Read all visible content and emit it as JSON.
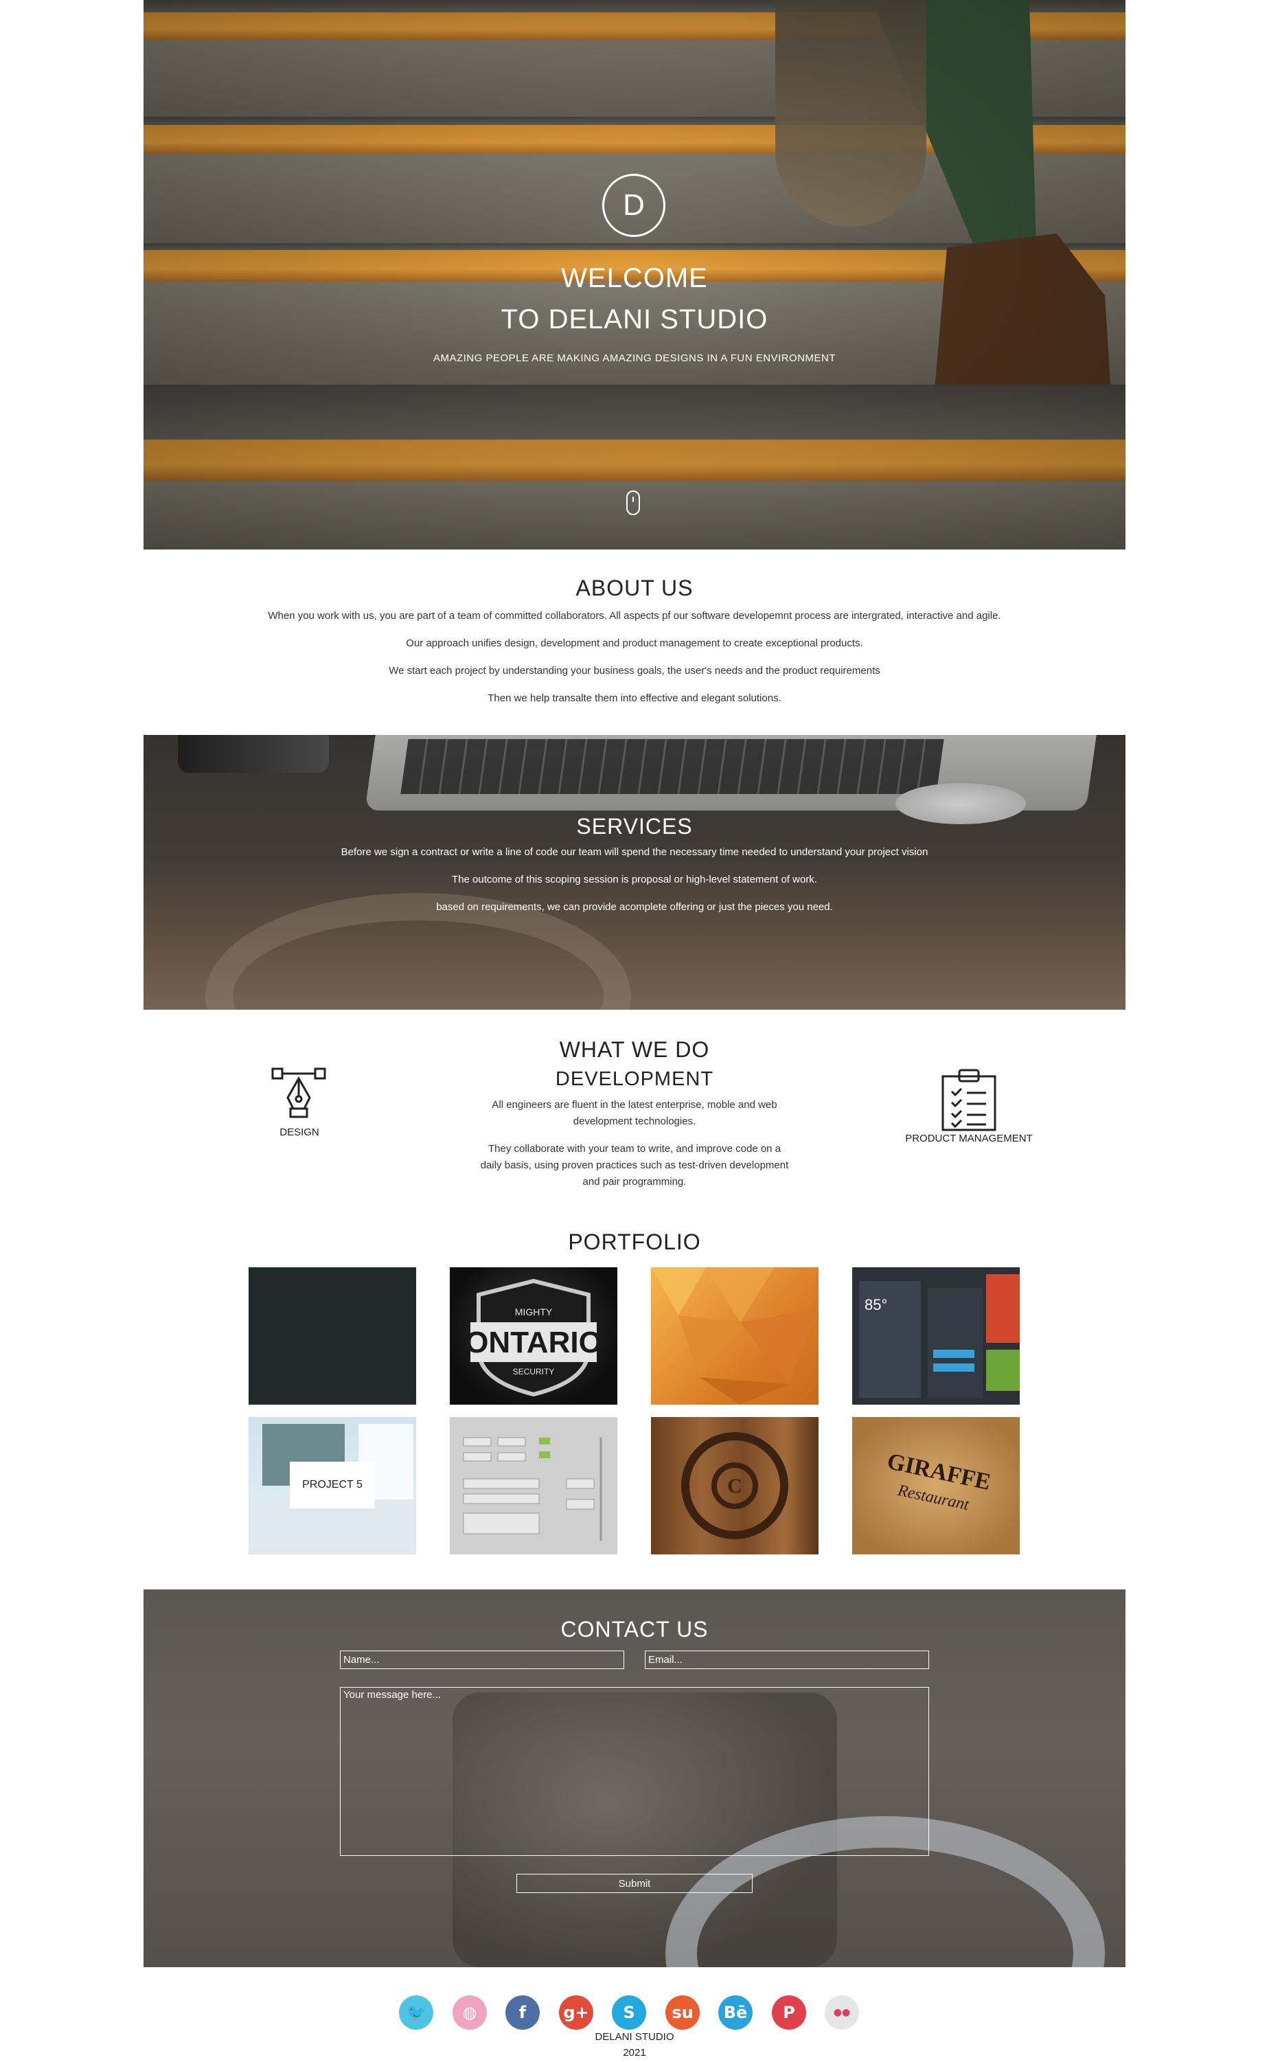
{
  "hero": {
    "logo_letter": "D",
    "title_line1": "WELCOME",
    "title_line2": "TO DELANI STUDIO",
    "tagline": "AMAZING PEOPLE ARE MAKING AMAZING DESIGNS IN A FUN ENVIRONMENT",
    "scroll_icon": "mouse-scroll-icon"
  },
  "about": {
    "title": "ABOUT US",
    "paragraphs": [
      "When you work with us, you are part of a team of committed collaborators. All aspects pf our software developemnt process are intergrated, interactive and agile.",
      "Our approach unifies design, development and product management to create exceptional products.",
      "We start each project by understanding your business goals, the user's needs and the product requirements",
      "Then we help transalte them into effective and elegant solutions."
    ]
  },
  "services": {
    "title": "SERVICES",
    "paragraphs": [
      "Before we sign a contract or write a line of code our team will spend the necessary time needed to understand your project vision",
      "The outcome of this scoping session is proposal or high-level statement of work.",
      "based on requirements, we can provide acomplete offering or just the pieces you need."
    ]
  },
  "what_we_do": {
    "title": "WHAT WE DO",
    "subtitle": "DEVELOPMENT",
    "paragraph1": "All engineers are fluent in the latest enterprise, moble and web development technologies.",
    "paragraph2": "They collaborate with your team to write, and improve code on a daily basis, using proven practices such as test-driven development and pair programming.",
    "design_label": "DESIGN",
    "design_icon": "pen-tool-icon",
    "product_label": "PRODUCT MANAGEMENT",
    "product_icon": "clipboard-checklist-icon"
  },
  "portfolio": {
    "title": "PORTFOLIO",
    "hover_label": "PROJECT 5"
  },
  "contact": {
    "title": "CONTACT US",
    "name_placeholder": "Name...",
    "email_placeholder": "Email...",
    "message_placeholder": "Your message here...",
    "submit_label": "Submit"
  },
  "footer": {
    "social": [
      {
        "icon": "twitter-icon",
        "glyph": "🐦",
        "color": "#4fc3e3"
      },
      {
        "icon": "dribbble-icon",
        "glyph": "◍",
        "color": "#f0a3bf"
      },
      {
        "icon": "facebook-icon",
        "glyph": "f",
        "color": "#4e6ea6"
      },
      {
        "icon": "google-plus-icon",
        "glyph": "g+",
        "color": "#e24a3a"
      },
      {
        "icon": "skype-icon",
        "glyph": "S",
        "color": "#23a8e0"
      },
      {
        "icon": "stumbleupon-icon",
        "glyph": "su",
        "color": "#ea5d2f"
      },
      {
        "icon": "behance-icon",
        "glyph": "Bē",
        "color": "#2aa3dc"
      },
      {
        "icon": "pinterest-icon",
        "glyph": "P",
        "color": "#e0404b"
      },
      {
        "icon": "flickr-icon",
        "glyph": "●●",
        "color": "#e6e6e6"
      }
    ],
    "brand": "DELANI STUDIO",
    "year": "2021"
  },
  "colors": {
    "hero_orange": "#f2a840",
    "text_dark": "#222222"
  }
}
